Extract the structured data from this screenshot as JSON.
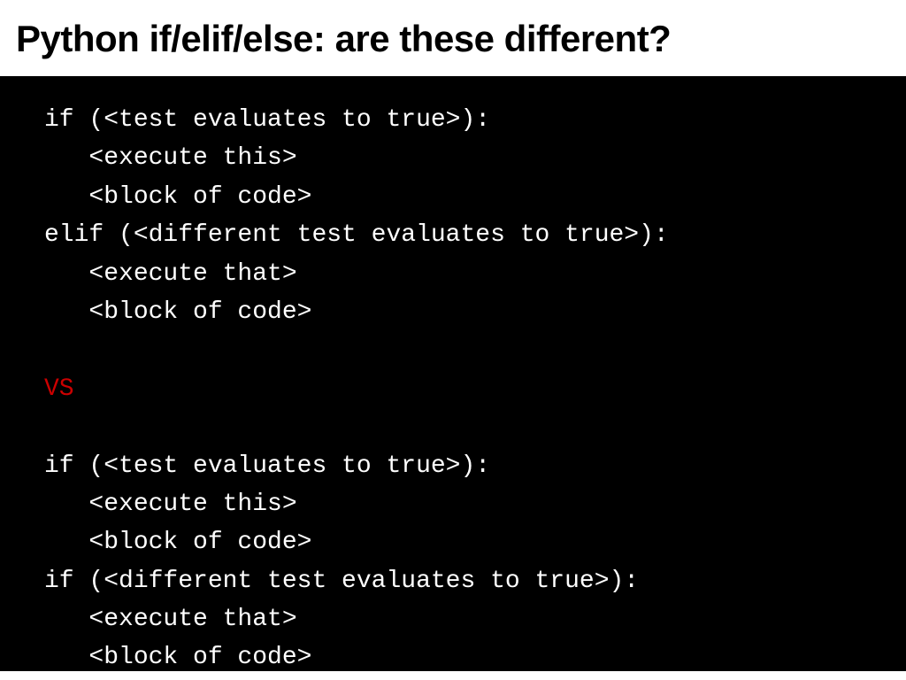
{
  "header": {
    "title": "Python if/elif/else: are these different?"
  },
  "code": {
    "block1": {
      "line1": "if (<test evaluates to true>):",
      "line2": "   <execute this>",
      "line3": "   <block of code>",
      "line4": "elif (<different test evaluates to true>):",
      "line5": "   <execute that>",
      "line6": "   <block of code>"
    },
    "separator": "VS",
    "block2": {
      "line1": "if (<test evaluates to true>):",
      "line2": "   <execute this>",
      "line3": "   <block of code>",
      "line4": "if (<different test evaluates to true>):",
      "line5": "   <execute that>",
      "line6": "   <block of code>"
    }
  }
}
